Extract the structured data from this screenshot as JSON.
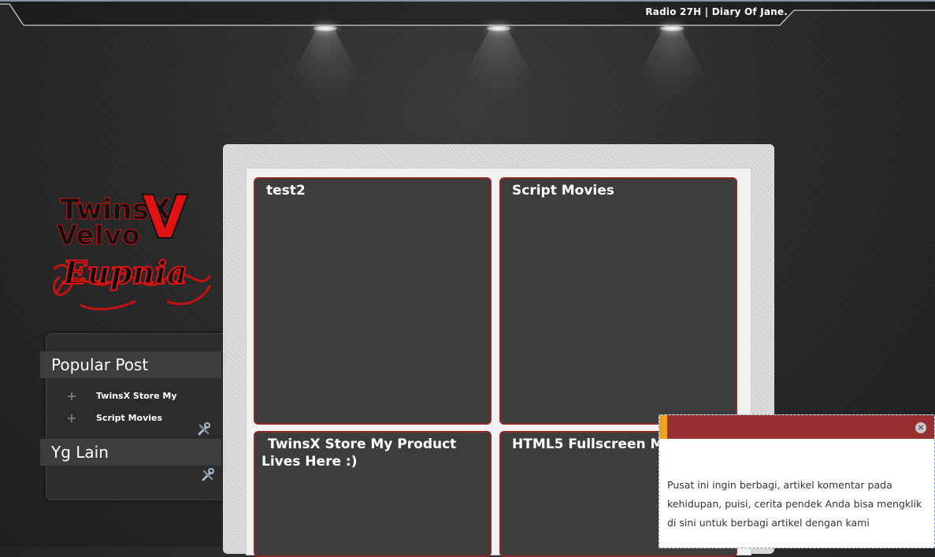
{
  "header": {
    "title": "Radio 27H | Diary Of Jane."
  },
  "logo": {
    "line1": "TwinsX",
    "line2": "VeIvo",
    "line3": "Eupnia",
    "mark": "V"
  },
  "sidebar": {
    "popular_title": "Popular Post",
    "popular_items": [
      {
        "label": "TwinsX Store My"
      },
      {
        "label": "Script Movies"
      }
    ],
    "other_title": "Yg Lain"
  },
  "posts": [
    {
      "title": "test2"
    },
    {
      "title": "Script Movies"
    },
    {
      "title": "TwinsX Store My Product Lives Here :)"
    },
    {
      "title": "HTML5 Fullscreen Ma"
    }
  ],
  "popup": {
    "text": "Pusat ini ingin berbagi, artikel komentar pada kehidupan, puisi, cerita pendek Anda bisa mengklik di sini untuk berbagi artikel dengan kami",
    "close_icon": "close-icon"
  },
  "colors": {
    "accent_red": "#9a2f31",
    "card_border": "#8e2a2a",
    "popup_accent": "#f0a11e"
  }
}
